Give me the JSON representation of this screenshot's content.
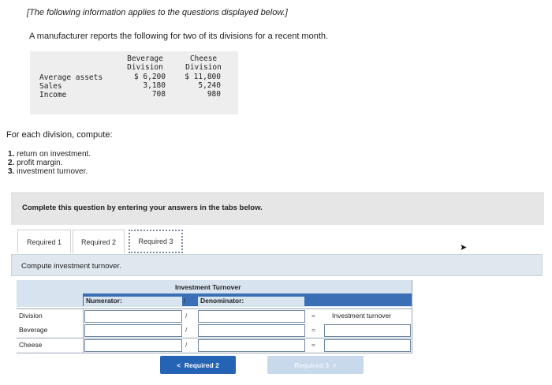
{
  "intro": {
    "note": "[The following information applies to the questions displayed below.]",
    "statement": "A manufacturer reports the following for two of its divisions for a recent month."
  },
  "data_table": {
    "col1_header_line1": "Beverage",
    "col1_header_line2": "Division",
    "col2_header_line1": "Cheese",
    "col2_header_line2": "Division",
    "rows": [
      {
        "label": "Average assets",
        "beverage": "$ 6,200",
        "cheese": "$ 11,800"
      },
      {
        "label": "Sales",
        "beverage": "3,180",
        "cheese": "5,240"
      },
      {
        "label": "Income",
        "beverage": "708",
        "cheese": "980"
      }
    ]
  },
  "compute": {
    "lead": "For each division, compute:",
    "items": [
      {
        "num": "1.",
        "text": "return on investment."
      },
      {
        "num": "2.",
        "text": "profit margin."
      },
      {
        "num": "3.",
        "text": "investment turnover."
      }
    ]
  },
  "instructions": "Complete this question by entering your answers in the tabs below.",
  "tabs": [
    "Required 1",
    "Required 2",
    "Required 3"
  ],
  "active_tab": "Required 3",
  "task": "Compute investment turnover.",
  "answer_grid": {
    "title": "Investment Turnover",
    "numerator_label": "Numerator:",
    "slash": "/",
    "denominator_label": "Denominator:",
    "equals": "=",
    "result_label": "Investment turnover",
    "rows": [
      {
        "label": "Division",
        "numerator": "",
        "denominator": "",
        "result": "Investment turnover"
      },
      {
        "label": "Beverage",
        "numerator": "",
        "denominator": "",
        "result": ""
      },
      {
        "label": "Cheese",
        "numerator": "",
        "denominator": "",
        "result": ""
      }
    ]
  },
  "nav": {
    "prev_label": "Required 2",
    "prev_glyph": "<",
    "next_label": "Required 3",
    "next_glyph": ">"
  },
  "colors": {
    "nav_prev_bg": "#2563b5",
    "nav_next_bg": "#c9d9ec",
    "grid_header_bg": "#d7e3ef",
    "task_bar_bg": "#dfe8ee"
  }
}
